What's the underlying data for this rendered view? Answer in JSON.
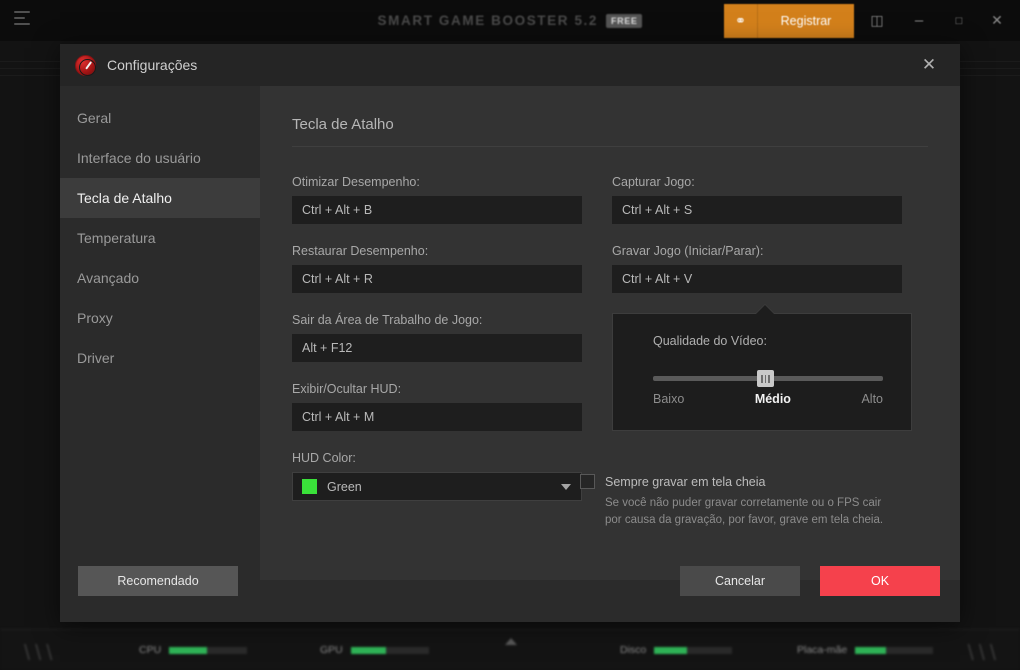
{
  "app": {
    "title": "SMART GAME BOOSTER 5.2",
    "badge": "FREE",
    "register_label": "Registrar",
    "key_icon": "key-icon",
    "feedback_icon": "feedback-icon",
    "minimize_icon": "minimize-icon",
    "maximize_icon": "maximize-icon",
    "close_icon": "close-icon",
    "menu_icon": "hamburger-icon"
  },
  "status_bar": {
    "items": [
      {
        "label": "CPU",
        "percent": 48
      },
      {
        "label": "GPU",
        "percent": 45
      },
      {
        "label": "Disco",
        "percent": 42
      },
      {
        "label": "Placa-mãe",
        "percent": 40
      }
    ],
    "accent_color": "#2fb457"
  },
  "dialog": {
    "title": "Configurações",
    "close_label": "✕",
    "icon": "speedometer-icon"
  },
  "sidebar": {
    "items": [
      {
        "label": "Geral",
        "active": false
      },
      {
        "label": "Interface do usuário",
        "active": false
      },
      {
        "label": "Tecla de Atalho",
        "active": true
      },
      {
        "label": "Temperatura",
        "active": false
      },
      {
        "label": "Avançado",
        "active": false
      },
      {
        "label": "Proxy",
        "active": false
      },
      {
        "label": "Driver",
        "active": false
      }
    ]
  },
  "panel": {
    "heading": "Tecla de Atalho",
    "left_fields": [
      {
        "label": "Otimizar Desempenho:",
        "value": "Ctrl + Alt + B"
      },
      {
        "label": "Restaurar Desempenho:",
        "value": "Ctrl + Alt + R"
      },
      {
        "label": "Sair da Área de Trabalho de Jogo:",
        "value": "Alt + F12"
      },
      {
        "label": "Exibir/Ocultar HUD:",
        "value": "Ctrl + Alt + M"
      }
    ],
    "hud_color": {
      "label": "HUD Color:",
      "value": "Green",
      "swatch": "#3ae13a"
    },
    "right_fields": [
      {
        "label": "Capturar Jogo:",
        "value": "Ctrl + Alt + S"
      },
      {
        "label": "Gravar Jogo (Iniciar/Parar):",
        "value": "Ctrl + Alt + V"
      }
    ],
    "video_quality": {
      "title": "Qualidade do Vídeo:",
      "low": "Baixo",
      "medium": "Médio",
      "high": "Alto",
      "current": "Médio",
      "position_percent": 47
    },
    "fullscreen": {
      "label": "Sempre gravar em tela cheia",
      "checked": false,
      "hint": "Se você não puder gravar corretamente ou o FPS cair por causa da gravação, por favor, grave em tela cheia."
    }
  },
  "footer": {
    "recommended_label": "Recomendado",
    "cancel_label": "Cancelar",
    "ok_label": "OK",
    "ok_color": "#f5414c"
  }
}
